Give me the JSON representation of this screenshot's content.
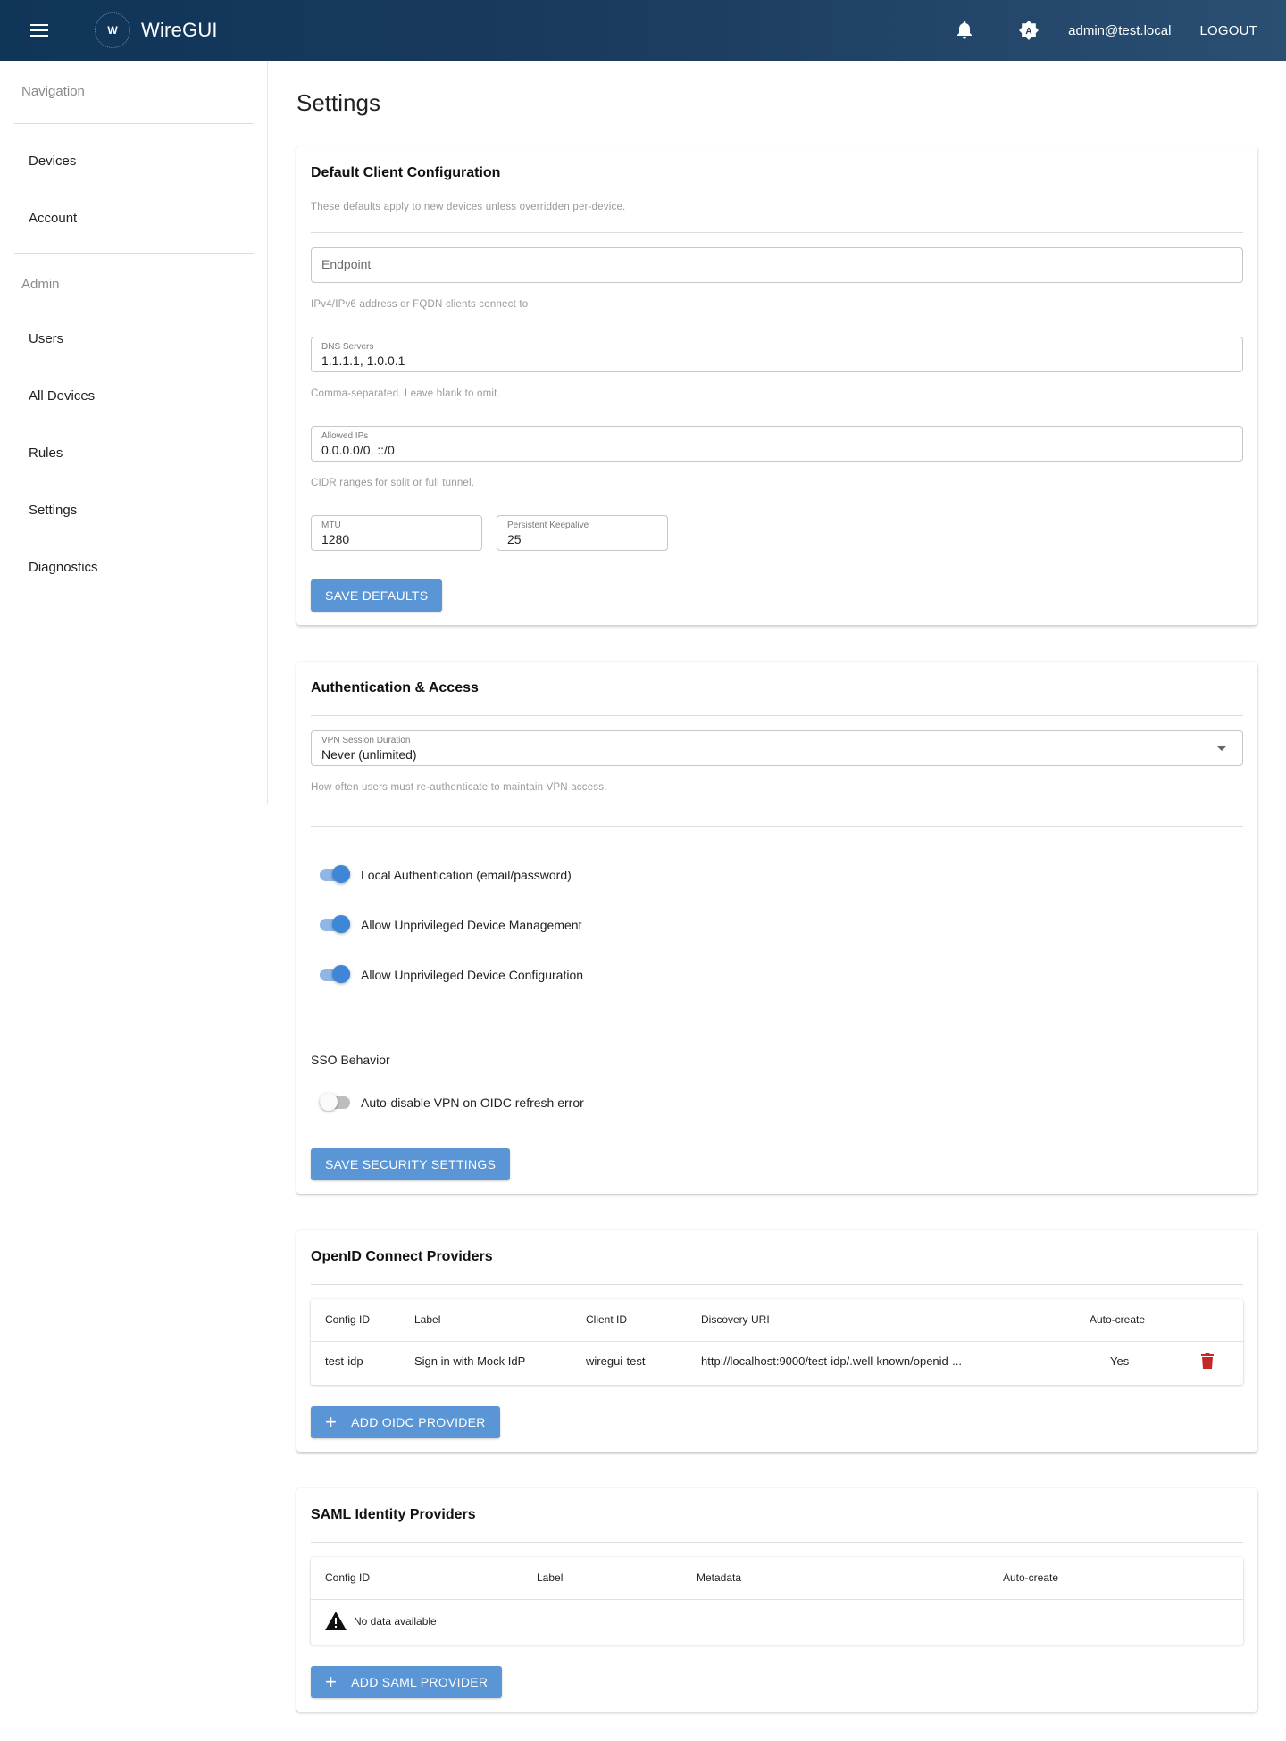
{
  "header": {
    "brand": "WireGUI",
    "logo_letter": "W",
    "user_email": "admin@test.local",
    "logout_label": "LOGOUT"
  },
  "sidebar": {
    "nav_heading": "Navigation",
    "nav_items": [
      {
        "label": "Devices"
      },
      {
        "label": "Account"
      }
    ],
    "admin_heading": "Admin",
    "admin_items": [
      {
        "label": "Users"
      },
      {
        "label": "All Devices"
      },
      {
        "label": "Rules"
      },
      {
        "label": "Settings"
      },
      {
        "label": "Diagnostics"
      }
    ]
  },
  "page": {
    "title": "Settings"
  },
  "client_config": {
    "title": "Default Client Configuration",
    "subtitle": "These defaults apply to new devices unless overridden per-device.",
    "endpoint_placeholder": "Endpoint",
    "endpoint_hint": "IPv4/IPv6 address or FQDN clients connect to",
    "dns_label": "DNS Servers",
    "dns_value": "1.1.1.1, 1.0.0.1",
    "dns_hint": "Comma-separated. Leave blank to omit.",
    "allowed_label": "Allowed IPs",
    "allowed_value": "0.0.0.0/0, ::/0",
    "allowed_hint": "CIDR ranges for split or full tunnel.",
    "mtu_label": "MTU",
    "mtu_value": "1280",
    "keepalive_label": "Persistent Keepalive",
    "keepalive_value": "25",
    "save_label": "SAVE DEFAULTS"
  },
  "auth": {
    "title": "Authentication & Access",
    "session_label": "VPN Session Duration",
    "session_value": "Never (unlimited)",
    "session_hint": "How often users must re-authenticate to maintain VPN access.",
    "toggles": [
      {
        "label": "Local Authentication (email/password)",
        "on": true
      },
      {
        "label": "Allow Unprivileged Device Management",
        "on": true
      },
      {
        "label": "Allow Unprivileged Device Configuration",
        "on": true
      }
    ],
    "sso_heading": "SSO Behavior",
    "sso_toggle": {
      "label": "Auto-disable VPN on OIDC refresh error",
      "on": false
    },
    "save_label": "SAVE SECURITY SETTINGS"
  },
  "oidc": {
    "title": "OpenID Connect Providers",
    "columns": [
      "Config ID",
      "Label",
      "Client ID",
      "Discovery URI",
      "Auto-create"
    ],
    "rows": [
      {
        "config_id": "test-idp",
        "label": "Sign in with Mock IdP",
        "client_id": "wiregui-test",
        "discovery_uri": "http://localhost:9000/test-idp/.well-known/openid-...",
        "auto_create": "Yes"
      }
    ],
    "add_label": "ADD OIDC PROVIDER"
  },
  "saml": {
    "title": "SAML Identity Providers",
    "columns": [
      "Config ID",
      "Label",
      "Metadata",
      "Auto-create"
    ],
    "empty_text": "No data available",
    "add_label": "ADD SAML PROVIDER"
  },
  "colors": {
    "header_dark": "#0f3558",
    "primary_button": "#5a95d6",
    "toggle_on": "#3f86d6",
    "delete_icon": "#c62828"
  }
}
